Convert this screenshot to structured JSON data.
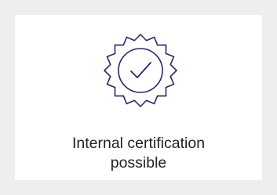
{
  "card": {
    "icon": "certificate-badge-checkmark-icon",
    "caption_line1": "Internal certification",
    "caption_line2": "possible"
  },
  "colors": {
    "page_background": "#eeeeee",
    "card_background": "#ffffff",
    "icon_stroke": "#2a2768",
    "text": "#222222"
  }
}
